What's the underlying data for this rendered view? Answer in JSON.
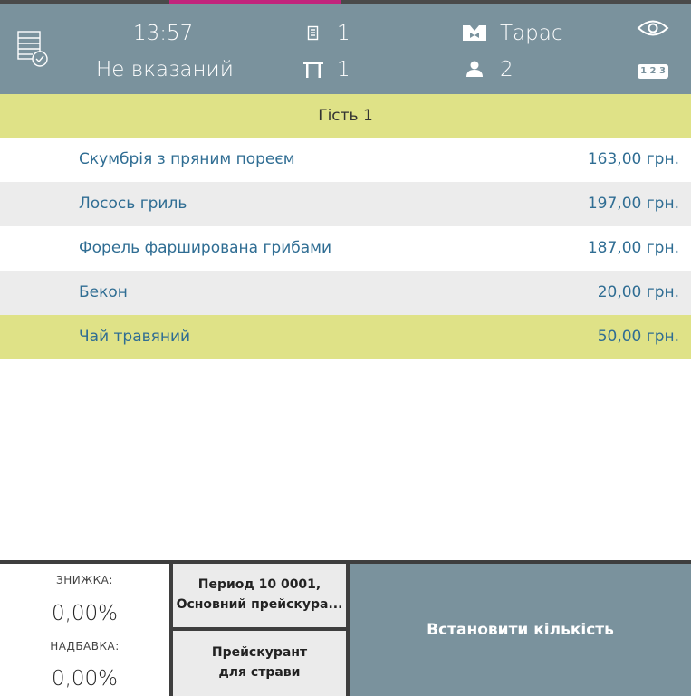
{
  "colors": {
    "header_bg": "#7a929d",
    "guest_bar": "#dfe287",
    "selected_row": "#dfe287",
    "alt_row": "#ececec",
    "item_text": "#2f6d93",
    "active_tab": "#c2237c"
  },
  "header": {
    "time": "13:57",
    "customer": "Не вказаний",
    "order_count": "1",
    "table_number": "1",
    "waiter": "Тарас",
    "guests": "2",
    "numbering_badge": "1 2 3",
    "icons": {
      "orders": "order-list-check-icon",
      "receipt": "receipt-icon",
      "table": "table-icon",
      "waiter": "waiter-icon",
      "guests": "person-icon",
      "view": "eye-icon"
    }
  },
  "guest": {
    "label": "Гість 1"
  },
  "items": [
    {
      "name": "Скумбрія з пряним пореєм",
      "price": "163,00 грн.",
      "bg": "#ffffff"
    },
    {
      "name": "Лосось гриль",
      "price": "197,00 грн.",
      "bg": "#ececec"
    },
    {
      "name": "Форель фарширована грибами",
      "price": "187,00 грн.",
      "bg": "#ffffff"
    },
    {
      "name": "Бекон",
      "price": "20,00 грн.",
      "bg": "#ececec"
    },
    {
      "name": "Чай травяний",
      "price": "50,00 грн.",
      "bg": "#dfe287"
    }
  ],
  "bottom": {
    "discount_label": "ЗНИЖКА:",
    "discount_value": "0,00%",
    "markup_label": "НАДБАВКА:",
    "markup_value": "0,00%",
    "period_line1": "Период 10 0001,",
    "period_line2": "Основний прейскура...",
    "pricelist_line1": "Прейскурант",
    "pricelist_line2": "для страви",
    "set_quantity": "Встановити кількість"
  }
}
